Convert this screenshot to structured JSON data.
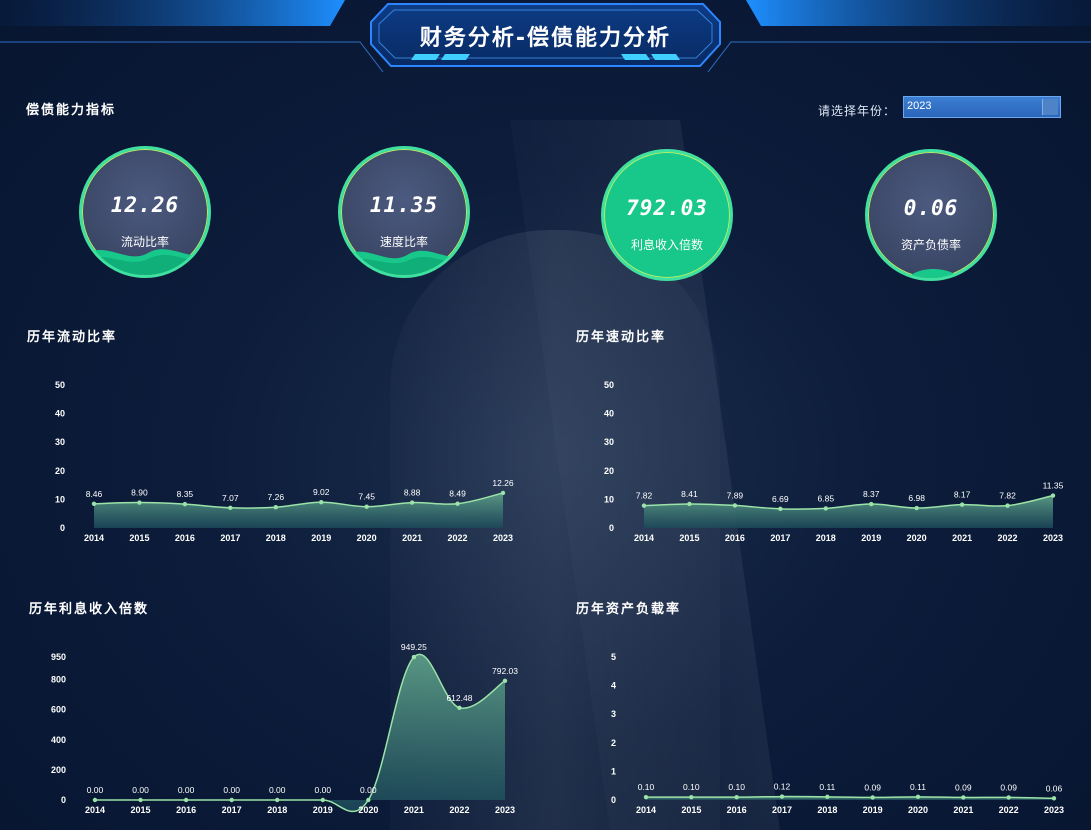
{
  "header": {
    "title": "财务分析-偿债能力分析"
  },
  "indicator_section_title": "偿债能力指标",
  "year_filter": {
    "label": "请选择年份：",
    "value": "2023"
  },
  "indicators": [
    {
      "value": "12.26",
      "label": "流动比率",
      "fill": 0.25
    },
    {
      "value": "11.35",
      "label": "速度比率",
      "fill": 0.23
    },
    {
      "value": "792.03",
      "label": "利息收入倍数",
      "fill": 1.0
    },
    {
      "value": "0.06",
      "label": "资产负债率",
      "fill": 0.06
    }
  ],
  "colors": {
    "accent": "#3fe0a0",
    "line": "#9be3a8",
    "area_top": "#5c9c86",
    "area_bottom": "#1c4a5a"
  },
  "chart_data": [
    {
      "type": "area",
      "title": "历年流动比率",
      "categories": [
        "2014",
        "2015",
        "2016",
        "2017",
        "2018",
        "2019",
        "2020",
        "2021",
        "2022",
        "2023"
      ],
      "values": [
        8.46,
        8.9,
        8.35,
        7.07,
        7.26,
        9.02,
        7.45,
        8.88,
        8.49,
        12.26
      ],
      "value_labels": [
        "8.46",
        "8.90",
        "8.35",
        "7.07",
        "7.26",
        "9.02",
        "7.45",
        "8.88",
        "8.49",
        "12.26"
      ],
      "yticks": [
        0,
        10,
        20,
        30,
        40,
        50
      ],
      "ylim": [
        0,
        50
      ]
    },
    {
      "type": "area",
      "title": "历年速动比率",
      "categories": [
        "2014",
        "2015",
        "2016",
        "2017",
        "2018",
        "2019",
        "2020",
        "2021",
        "2022",
        "2023"
      ],
      "values": [
        7.82,
        8.41,
        7.89,
        6.69,
        6.85,
        8.37,
        6.98,
        8.17,
        7.82,
        11.35
      ],
      "value_labels": [
        "7.82",
        "8.41",
        "7.89",
        "6.69",
        "6.85",
        "8.37",
        "6.98",
        "8.17",
        "7.82",
        "11.35"
      ],
      "yticks": [
        0,
        10,
        20,
        30,
        40,
        50
      ],
      "ylim": [
        0,
        50
      ]
    },
    {
      "type": "area",
      "title": "历年利息收入倍数",
      "categories": [
        "2014",
        "2015",
        "2016",
        "2017",
        "2018",
        "2019",
        "2020",
        "2021",
        "2022",
        "2023"
      ],
      "values": [
        0,
        0,
        0,
        0,
        0,
        0,
        0,
        949.25,
        612.48,
        792.03
      ],
      "value_labels": [
        "0.00",
        "0.00",
        "0.00",
        "0.00",
        "0.00",
        "0.00",
        "0.00",
        "949.25",
        "612.48",
        "792.03"
      ],
      "yticks": [
        0,
        200,
        400,
        600,
        800,
        950
      ],
      "ylim": [
        0,
        950
      ]
    },
    {
      "type": "area",
      "title": "历年资产负载率",
      "categories": [
        "2014",
        "2015",
        "2016",
        "2017",
        "2018",
        "2019",
        "2020",
        "2021",
        "2022",
        "2023"
      ],
      "values": [
        0.1,
        0.1,
        0.1,
        0.12,
        0.11,
        0.09,
        0.11,
        0.09,
        0.09,
        0.06
      ],
      "value_labels": [
        "0.10",
        "0.10",
        "0.10",
        "0.12",
        "0.11",
        "0.09",
        "0.11",
        "0.09",
        "0.09",
        "0.06"
      ],
      "yticks": [
        0,
        1,
        2,
        3,
        4,
        5
      ],
      "ylim": [
        0,
        5
      ]
    }
  ]
}
